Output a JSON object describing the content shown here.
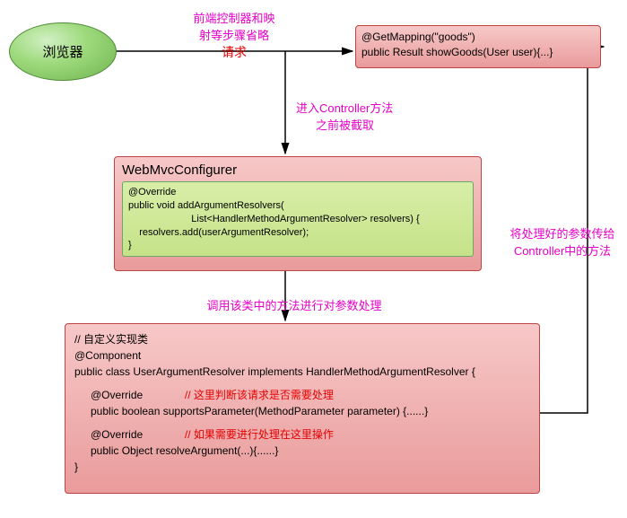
{
  "browser": {
    "label": "浏览器"
  },
  "topLabel": {
    "line1": "前端控制器和映",
    "line2": "射等步骤省略",
    "line3": "请求"
  },
  "controller": {
    "line1": "@GetMapping(\"goods\")",
    "line2": "public Result showGoods(User user){...}"
  },
  "intercept": {
    "line1": "进入Controller方法",
    "line2": "之前被截取"
  },
  "configurer": {
    "title": "WebMvcConfigurer",
    "code": "@Override\npublic void addArgumentResolvers(\n                       List<HandlerMethodArgumentResolver> resolvers) {\n    resolvers.add(userArgumentResolver);\n}"
  },
  "callLabel": "调用该类中的方法进行对参数处理",
  "passLabel": {
    "line1": "将处理好的参数传给",
    "line2": "Controller中的方法"
  },
  "resolver": {
    "c1": "// 自定义实现类",
    "c2": "@Component",
    "c3": "public class UserArgumentResolver implements HandlerMethodArgumentResolver {",
    "orA": "@Override",
    "noteA": "// 这里判断该请求是否需要处理",
    "mA": "public boolean supportsParameter(MethodParameter parameter) {......}",
    "orB": "@Override",
    "noteB": "// 如果需要进行处理在这里操作",
    "mB": "public Object resolveArgument(...){......}",
    "close": "}"
  }
}
